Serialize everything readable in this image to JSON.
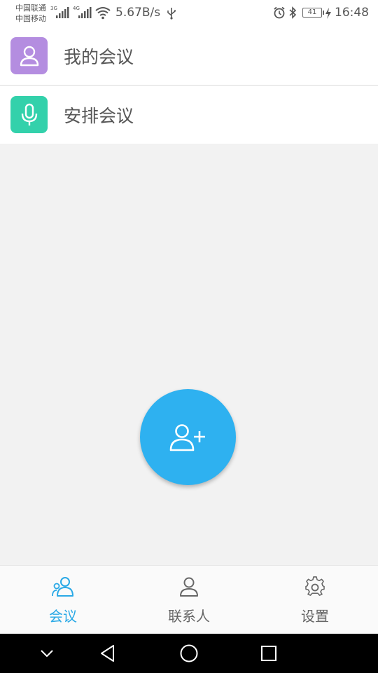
{
  "status_bar": {
    "carrier_1": "中国联通",
    "carrier_2": "中国移动",
    "net_1": "3G",
    "net_2": "4G",
    "speed": "5.67B/s",
    "battery": "41",
    "time": "16:48"
  },
  "menu": {
    "items": [
      {
        "label": "我的会议",
        "icon": "person-icon",
        "color": "#b48de0"
      },
      {
        "label": "安排会议",
        "icon": "microphone-icon",
        "color": "#33d1ab"
      }
    ]
  },
  "fab": {
    "icon": "add-contact-icon",
    "color": "#2eb1f0"
  },
  "tabs": [
    {
      "label": "会议",
      "icon": "meeting-people-icon",
      "active": true
    },
    {
      "label": "联系人",
      "icon": "contact-person-icon",
      "active": false
    },
    {
      "label": "设置",
      "icon": "gear-icon",
      "active": false
    }
  ],
  "colors": {
    "tab_active": "#2aa9e6",
    "tab_inactive": "#666666"
  }
}
